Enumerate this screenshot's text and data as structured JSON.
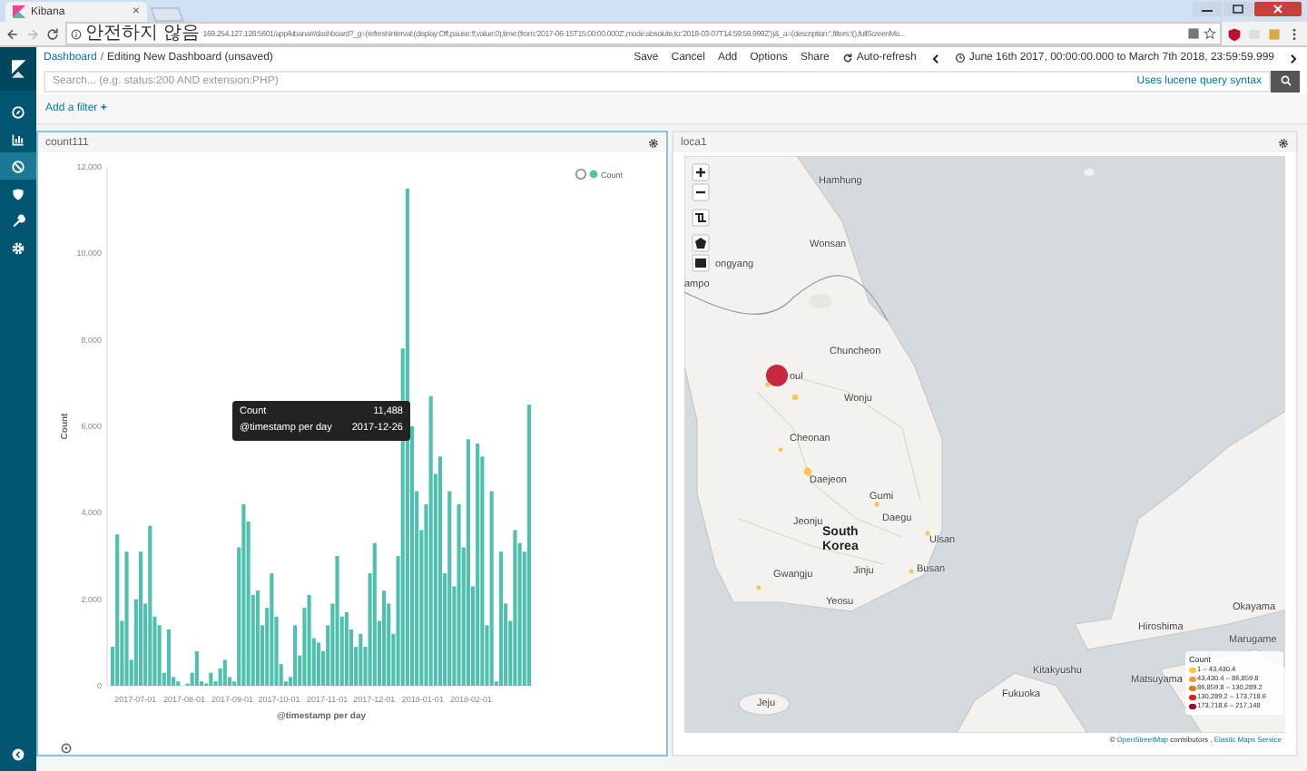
{
  "browser": {
    "tab": {
      "title": "Kibana",
      "close": "×"
    },
    "security": "안전하지 않음",
    "url": "169.254.127.128:5601/app/kibana#/dashboard?_g=(refreshInterval:(display:Off,pause:!f,value:0),time:(from:'2017-06-15T15:00:00.000Z',mode:absolute,to:'2018-03-07T14:59:59.999Z'))&_a=(description:'',filters:!(),fullScreenMo..."
  },
  "sidebar": {
    "items": [
      {
        "kind": "discover",
        "selected": false
      },
      {
        "kind": "visualize",
        "selected": false
      },
      {
        "kind": "dashboard",
        "selected": true
      },
      {
        "kind": "timelion",
        "selected": false
      },
      {
        "kind": "devtools",
        "selected": false
      },
      {
        "kind": "management",
        "selected": false
      }
    ]
  },
  "breadcrumbs": [
    "Dashboard",
    "Editing New Dashboard (unsaved)"
  ],
  "breadcrumb_separator": "/",
  "menu": [
    "Save",
    "Cancel",
    "Add",
    "Options",
    "Share",
    "Auto-refresh"
  ],
  "time_range": "June 16th 2017, 00:00:00.000 to March 7th 2018, 23:59:59.999",
  "search": {
    "placeholder": "Search... (e.g. status:200 AND extension:PHP)",
    "syntax_link": "Uses lucene query syntax"
  },
  "add_filter": "Add a filter",
  "add_filter_icon": "+",
  "panels": [
    {
      "title": "count111",
      "x_labels": [
        "2017-07-01",
        "2017-08-01",
        "2017-09-01",
        "2017-10-01",
        "2017-11-01",
        "2017-12-01",
        "2018-01-01",
        "2018-02-01"
      ],
      "tooltip": {
        "rows": [
          {
            "label": "Count",
            "value": "11,488"
          },
          {
            "label": "@timestamp per day",
            "value": "2017-12-26"
          }
        ]
      },
      "chart_data": {
        "type": "bar",
        "xlabel": "@timestamp per day",
        "ylabel": "Count",
        "ylim": [
          0,
          12000
        ],
        "yticks": [
          0,
          {
            "value": 2000,
            "label": "2,000"
          },
          {
            "value": 4000,
            "label": "4,000"
          },
          {
            "value": 6000,
            "label": "6,000"
          },
          {
            "value": 8000,
            "label": "8,000"
          },
          {
            "value": 10000,
            "label": "10,000"
          },
          {
            "value": 12000,
            "label": "12,000"
          }
        ],
        "series": [
          {
            "name": "Count",
            "color": "#4fbfae",
            "values": [
              900,
              3500,
              1500,
              3100,
              600,
              2000,
              3100,
              1900,
              3700,
              1600,
              1400,
              300,
              1300,
              200,
              100,
              0,
              50,
              300,
              800,
              100,
              50,
              300,
              100,
              400,
              600,
              200,
              100,
              3200,
              4200,
              3800,
              2100,
              2200,
              1400,
              1800,
              2600,
              1600,
              500,
              100,
              200,
              1400,
              700,
              1800,
              2100,
              1100,
              1000,
              800,
              1400,
              1900,
              3000,
              1600,
              1700,
              1300,
              900,
              1200,
              900,
              2600,
              3300,
              1500,
              2200,
              1900,
              1200,
              3000,
              7800,
              11500,
              6000,
              4500,
              3600,
              4200,
              6700,
              4900,
              5300,
              2600,
              4500,
              2300,
              4200,
              3200,
              5700,
              2300,
              5600,
              5300,
              1400,
              4500,
              100,
              3100,
              1900,
              1500,
              3600,
              3300,
              3100,
              6500
            ]
          }
        ]
      }
    },
    {
      "title": "loca1",
      "map": {
        "labels": [
          "Hamhung",
          "Wonsan",
          "ongyang",
          "ampo",
          "Chuncheon",
          "oul",
          "Wonju",
          "Cheonan",
          "Daejeon",
          "Gumi",
          "Daegu",
          "Jeonju",
          "South Korea",
          "Ulsan",
          "Gwangju",
          "Jinju",
          "Busan",
          "Yeosu",
          "Okayama",
          "Hiroshima",
          "Marugame",
          "Kitakyushu",
          "Matsuyama",
          "Fukuoka",
          "Jeju"
        ],
        "markers": [
          {
            "color": "#c8283f"
          },
          {
            "color": "#f7c84a"
          },
          {
            "color": "#f7c84a"
          },
          {
            "color": "#f7c84a"
          },
          {
            "color": "#f7c84a"
          },
          {
            "color": "#f7c84a"
          },
          {
            "color": "#f7c84a"
          },
          {
            "color": "#f7c84a"
          },
          {
            "color": "#f7c84a"
          }
        ],
        "legend": {
          "title": "Count",
          "items": [
            {
              "label": "1 – 43,430.4",
              "color": "#f7c84a"
            },
            {
              "label": "43,430.4 – 86,859.8",
              "color": "#f0a030"
            },
            {
              "label": "86,859.8 – 130,289.2",
              "color": "#e8741c"
            },
            {
              "label": "130,289.2 – 173,718.6",
              "color": "#d81e1e"
            },
            {
              "label": "173,718.6 – 217,148",
              "color": "#a5001e"
            }
          ]
        },
        "attribution": {
          "prefix": "©",
          "osm": "OpenStreetMap",
          "middle": "contributors ,",
          "ems": "Elastic Maps Service"
        }
      }
    }
  ]
}
